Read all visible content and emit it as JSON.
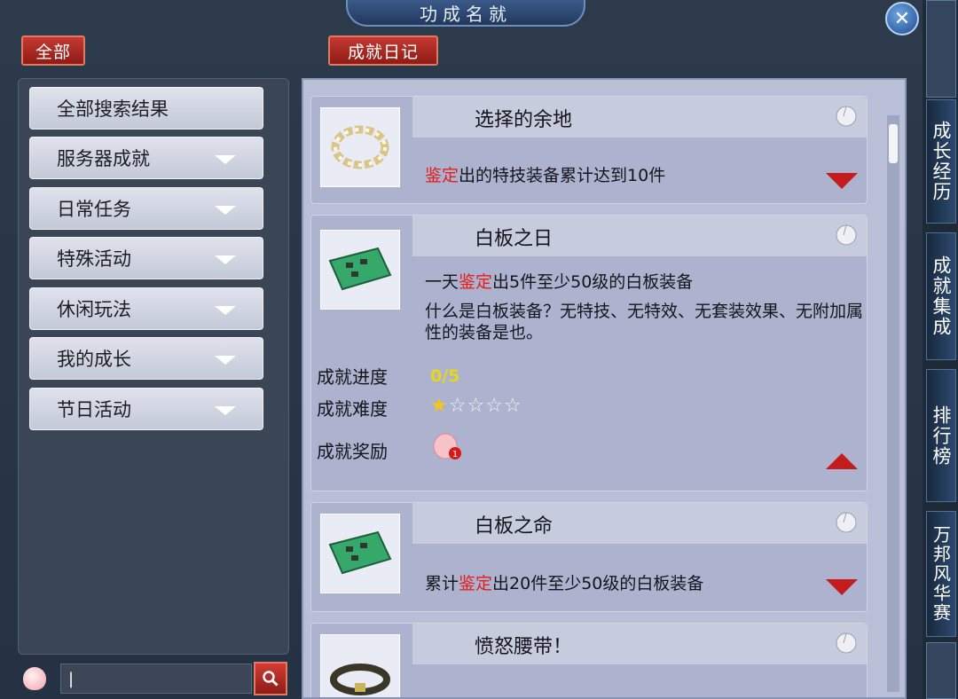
{
  "window": {
    "title": "功成名就",
    "close_icon": "close-icon"
  },
  "tabs": {
    "all_label": "全部",
    "diary_label": "成就日记"
  },
  "sidebar": {
    "items": [
      {
        "label": "全部搜索结果",
        "has_arrow": false
      },
      {
        "label": "服务器成就",
        "has_arrow": true
      },
      {
        "label": "日常任务",
        "has_arrow": true
      },
      {
        "label": "特殊活动",
        "has_arrow": true
      },
      {
        "label": "休闲玩法",
        "has_arrow": true
      },
      {
        "label": "我的成长",
        "has_arrow": true
      },
      {
        "label": "节日活动",
        "has_arrow": true
      }
    ]
  },
  "search": {
    "value": "|",
    "icon": "search-icon"
  },
  "achievements": [
    {
      "title": "选择的余地",
      "desc_prefix": "",
      "desc_highlight": "鉴定",
      "desc_suffix": "出的特技装备累计达到10件",
      "icon": "pearl-bracelet-icon",
      "expanded": false
    },
    {
      "title": "白板之日",
      "desc_prefix": "一天",
      "desc_highlight": "鉴定",
      "desc_suffix": "出5件至少50级的白板装备",
      "note": "什么是白板装备？无特技、无特效、无套装效果、无附加属性的装备是也。",
      "icon": "green-equipment-icon",
      "expanded": true,
      "progress_label": "成就进度",
      "progress_value": "0/5",
      "difficulty_label": "成就难度",
      "difficulty_stars": 1,
      "difficulty_max": 5,
      "reward_label": "成就奖励",
      "reward_count": "1"
    },
    {
      "title": "白板之命",
      "desc_prefix": "累计",
      "desc_highlight": "鉴定",
      "desc_suffix": "出20件至少50级的白板装备",
      "icon": "green-equipment-icon",
      "expanded": false
    },
    {
      "title": "愤怒腰带！",
      "icon": "belt-icon",
      "expanded": false
    }
  ],
  "side_tabs": [
    "成长经历",
    "成就集成",
    "排行榜",
    "万邦风华赛"
  ],
  "colors": {
    "highlight": "#e21d1d",
    "progress": "#e7d61a",
    "button_red": "#b32a24"
  }
}
